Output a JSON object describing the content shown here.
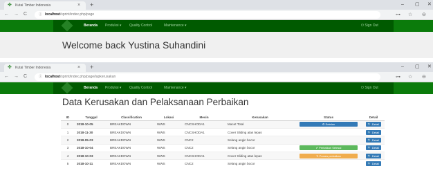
{
  "windows": [
    {
      "tab_title": "Kutai Timber Indonesia",
      "url_host": "localhost",
      "url_path": "/sprint/index.php/page",
      "nav": {
        "home": "Beranda",
        "produksi": "Produksi ▾",
        "qc": "Quality Control",
        "maintenance": "Maintenance ▾",
        "signout": "⏻ Sign Out"
      },
      "welcome": "Welcome back Yustina Suhandini"
    },
    {
      "tab_title": "Kutai Timber Indonesia",
      "url_host": "localhost",
      "url_path": "/sprint/index.php/page/lapkerusakan",
      "nav": {
        "home": "Beranda",
        "produksi": "Produksi ▾",
        "qc": "Quality Control",
        "maintenance": "Maintenance ▾",
        "signout": "⏻ Sign Out"
      },
      "heading": "Data Kerusakan dan Pelaksanaan Perbaikan",
      "table": {
        "columns": [
          "ID",
          "Tanggal",
          "Classification",
          "Lokasi",
          "Mesin",
          "Kerusakan",
          "Status",
          "Detail"
        ],
        "rows": [
          {
            "id": "0",
            "tanggal": "2018-10-05",
            "classification": "BREAKDOWN",
            "lokasi": "WWS",
            "mesin": "CNCSHODA1",
            "kerusakan": "Macet Total",
            "status": "⚙ Setelan",
            "status_color": "#337ab7",
            "detail": "🔍 Detail"
          },
          {
            "id": "1",
            "tanggal": "2018-11-30",
            "classification": "BREAKDOWN",
            "lokasi": "WWS",
            "mesin": "CNCSHODA1",
            "kerusakan": "Cover Sliding atas lepas",
            "status": "",
            "status_color": "",
            "detail": "🔍 Detail"
          },
          {
            "id": "2",
            "tanggal": "2018-05-03",
            "classification": "BREAKDOWN",
            "lokasi": "WWS",
            "mesin": "CNC2",
            "kerusakan": "Selang angin bocor",
            "status": "",
            "status_color": "",
            "detail": "🔍 Detail"
          },
          {
            "id": "3",
            "tanggal": "2018-10-04",
            "classification": "BREAKDOWN",
            "lokasi": "WWS",
            "mesin": "CNC2",
            "kerusakan": "Selang angin bocor",
            "status": "✔ Perbaikan Selesai",
            "status_color": "#5cb85c",
            "detail": "🔍 Detail"
          },
          {
            "id": "4",
            "tanggal": "2018-10-03",
            "classification": "BREAKDOWN",
            "lokasi": "WWS",
            "mesin": "CNCSHODA1",
            "kerusakan": "Cover Sliding atas lepas",
            "status": "✎ Proses perbaikan",
            "status_color": "#f0ad4e",
            "detail": "🔍 Detail"
          },
          {
            "id": "5",
            "tanggal": "2018-10-11",
            "classification": "BREAKDOWN",
            "lokasi": "WWS",
            "mesin": "CNC2",
            "kerusakan": "Selang angin bocor",
            "status": "",
            "status_color": "",
            "detail": "🔍 Detail"
          }
        ]
      }
    }
  ],
  "browser_icons": {
    "back": "←",
    "forward": "→",
    "reload": "C",
    "info": "ⓘ",
    "key": "⊶",
    "star": "☆",
    "account": "⊖",
    "minimize": "–",
    "maximize": "▢",
    "close": "✕",
    "tab_close": "×",
    "new_tab": "+",
    "favicon": "✤"
  },
  "colors": {
    "navbar": "#0b7b0b",
    "navbar_inner": "#005a00",
    "primary": "#337ab7",
    "success": "#5cb85c",
    "warning": "#f0ad4e"
  }
}
